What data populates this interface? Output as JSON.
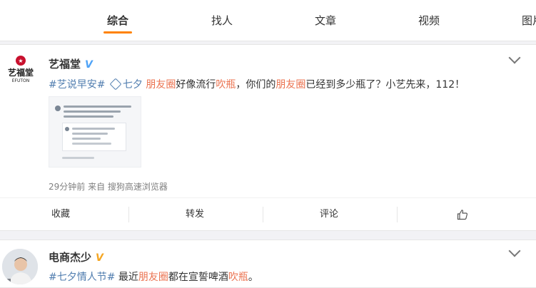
{
  "tabs": [
    {
      "label": "综合",
      "active": true
    },
    {
      "label": "找人",
      "active": false
    },
    {
      "label": "文章",
      "active": false
    },
    {
      "label": "视频",
      "active": false
    },
    {
      "label": "图片",
      "active": false
    }
  ],
  "post1": {
    "username": "艺福堂",
    "verified_badge": "V",
    "logo_text": "艺福堂",
    "logo_sub": "EFUTON",
    "text": {
      "hashtag": "#艺说早安#",
      "link_label": "七夕",
      "kw1": "朋友圈",
      "t1": "好像流行",
      "kw2": "吹瓶",
      "t2": "，你们的",
      "kw3": "朋友圈",
      "t3": "已经到多少瓶了？小艺先来，112！"
    },
    "meta": "29分钟前 来自 搜狗高速浏览器",
    "actions": {
      "collect": "收藏",
      "repost": "转发",
      "comment": "评论"
    }
  },
  "post2": {
    "username": "电商杰少",
    "verified_badge": "V",
    "text": {
      "hashtag": "#七夕情人节#",
      "t1": " 最近",
      "kw1": "朋友圈",
      "t2": "都在宣誓啤酒",
      "kw2": "吹瓶",
      "t3": "。"
    }
  },
  "colors": {
    "accent": "#ff8200",
    "link_blue": "#507daf",
    "keyword_red": "#eb7350",
    "badge_blue": "#4fa3f7",
    "badge_orange": "#f5a623"
  }
}
